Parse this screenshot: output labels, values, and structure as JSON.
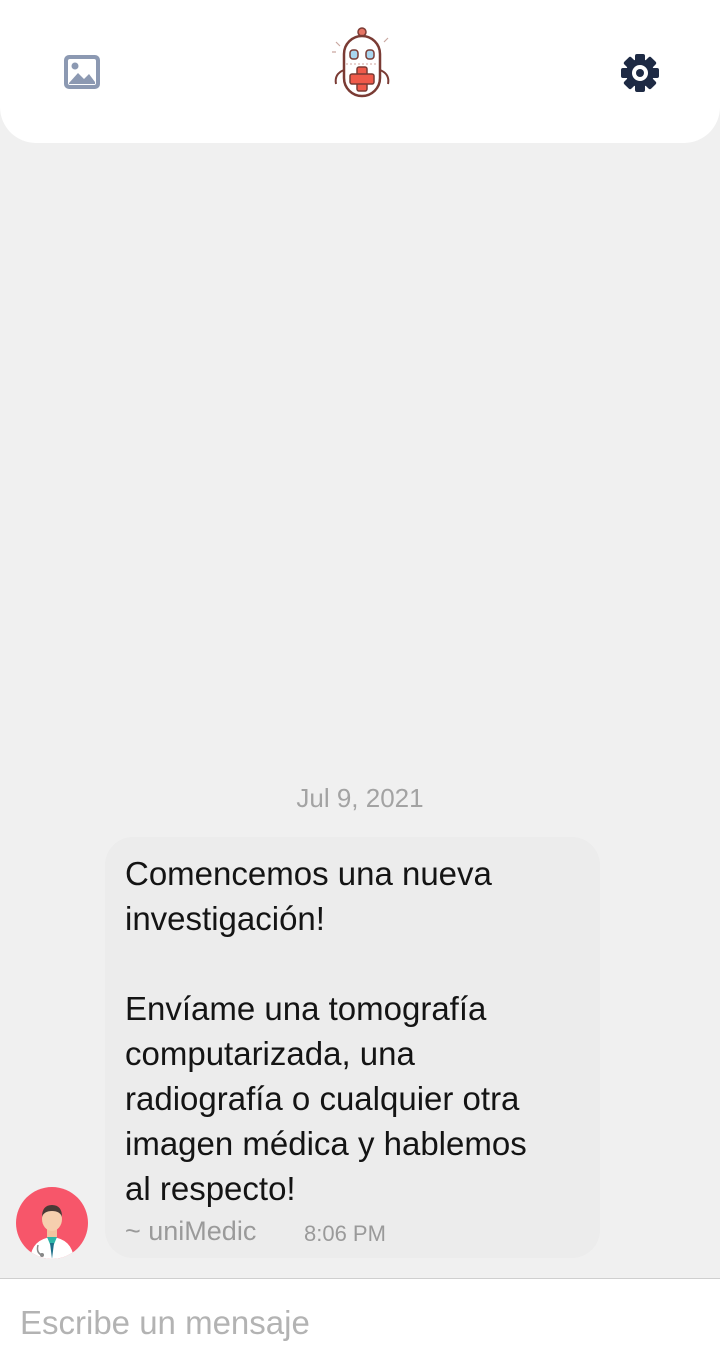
{
  "header": {
    "gallery_icon": "image-icon",
    "logo_icon": "robot-doctor-logo",
    "settings_icon": "gear-icon"
  },
  "chat": {
    "date": "Jul 9, 2021",
    "messages": [
      {
        "text": "Comencemos una nueva\ninvestigación!\n\nEnvíame una tomografía\ncomputarizada, una\nradiografía o cualquier otra\nimagen médica y hablemos\nal respecto!",
        "sender": "~ uniMedic",
        "time": "8:06 PM",
        "avatar_icon": "doctor-avatar-icon"
      }
    ]
  },
  "composer": {
    "placeholder": "Escribe un mensaje",
    "value": ""
  },
  "colors": {
    "background": "#f0f0f0",
    "header": "#ffffff",
    "bubble": "#ececec",
    "avatar_bg": "#f7566a",
    "gear": "#1e2a44",
    "image_icon": "#8c99b2"
  }
}
